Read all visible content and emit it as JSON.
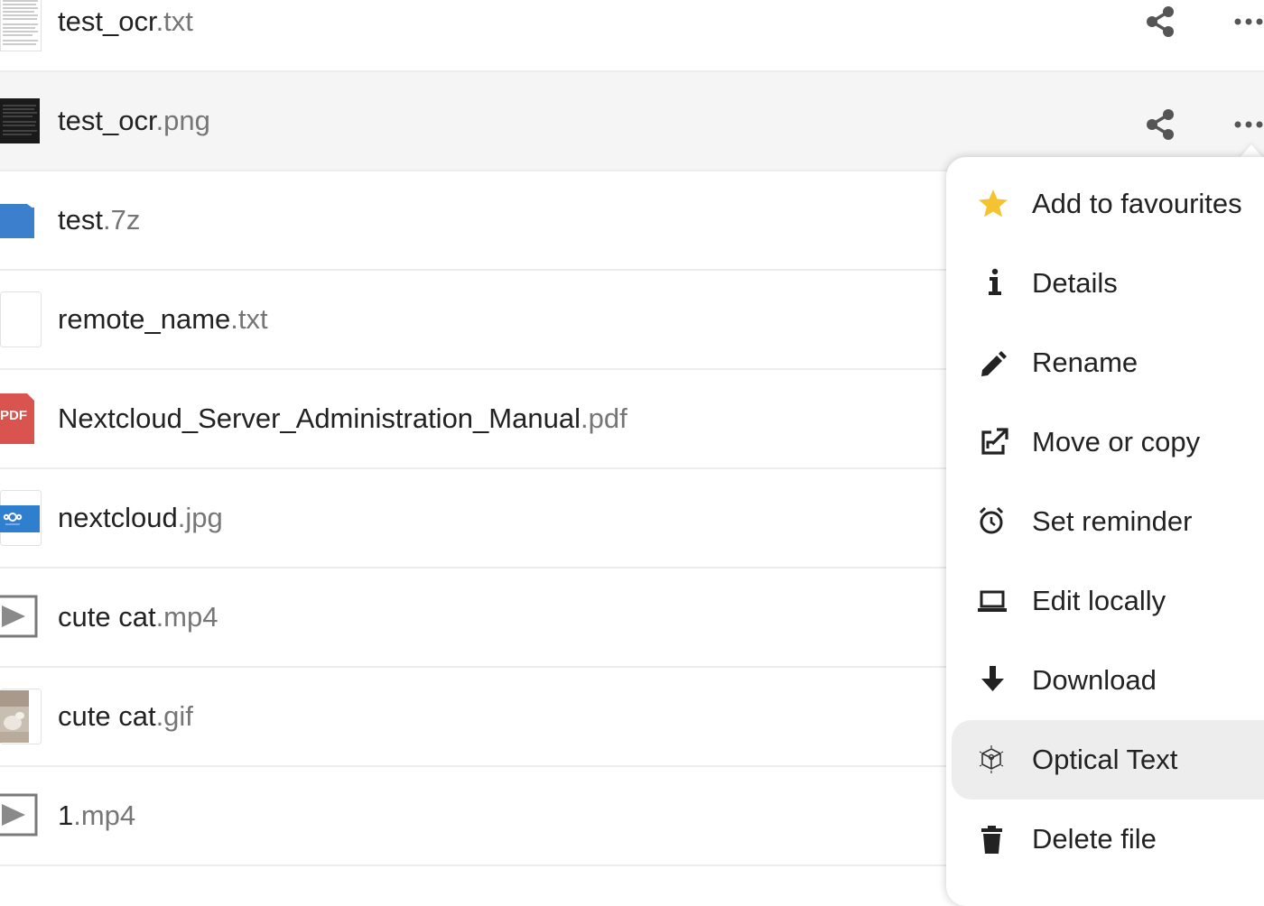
{
  "files": [
    {
      "name": "test_ocr",
      "ext": ".txt",
      "thumb": "text-document-thumbnail",
      "active": false
    },
    {
      "name": "test_ocr",
      "ext": ".png",
      "thumb": "dark-image-thumbnail",
      "active": true
    },
    {
      "name": "test",
      "ext": ".7z",
      "thumb": "archive-folder-icon",
      "active": false
    },
    {
      "name": "remote_name",
      "ext": ".txt",
      "thumb": "blank-document-thumbnail",
      "active": false
    },
    {
      "name": "Nextcloud_Server_Administration_Manual",
      "ext": ".pdf",
      "thumb": "pdf-icon",
      "active": false
    },
    {
      "name": "nextcloud",
      "ext": ".jpg",
      "thumb": "nextcloud-logo-thumbnail",
      "active": false
    },
    {
      "name": "cute cat",
      "ext": ".mp4",
      "thumb": "video-icon",
      "active": false
    },
    {
      "name": "cute cat",
      "ext": ".gif",
      "thumb": "cat-photo-thumbnail",
      "active": false
    },
    {
      "name": "1",
      "ext": ".mp4",
      "thumb": "video-icon",
      "active": false
    }
  ],
  "pdf_badge": "PDF",
  "menu": {
    "items": [
      {
        "label": "Add to favourites",
        "icon": "star-icon"
      },
      {
        "label": "Details",
        "icon": "info-icon"
      },
      {
        "label": "Rename",
        "icon": "pencil-icon"
      },
      {
        "label": "Move or copy",
        "icon": "external-link-icon"
      },
      {
        "label": "Set reminder",
        "icon": "alarm-clock-icon"
      },
      {
        "label": "Edit locally",
        "icon": "laptop-icon"
      },
      {
        "label": "Download",
        "icon": "download-arrow-icon"
      },
      {
        "label": "Optical Text",
        "icon": "ocr-cube-icon"
      },
      {
        "label": "Delete file",
        "icon": "trash-icon"
      }
    ],
    "highlighted_index": 7
  },
  "colors": {
    "star": "#f4c430",
    "folder_blue": "#3b7fcd",
    "pdf_red": "#d9534f",
    "nextcloud_blue": "#2f7fcf",
    "icon_gray": "#555555"
  }
}
